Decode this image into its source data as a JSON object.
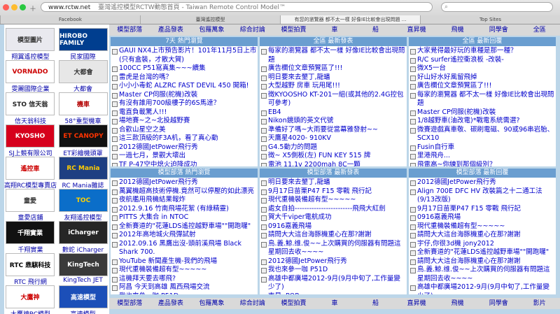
{
  "browser": {
    "url": "www.rctw.net",
    "title": "臺灣遙控模型RCTW動態首頁 - Taiwan Remote Control Model™",
    "tabs": [
      "Facebook",
      "臺灣遙控模型",
      "有您的瀏覽器 都不太一樣 好像IE比較會出現問題 ...",
      "Top Sites"
    ]
  },
  "nav": [
    "模型部落",
    "產品發表",
    "包羅萬象",
    "綜合討論",
    "模型拍賣",
    "車",
    "船",
    "直昇機",
    "飛機",
    "同學會",
    "全區"
  ],
  "nav_bottom": [
    "模型部落",
    "產品發表",
    "包羅萬象",
    "綜合討論",
    "模型拍賣",
    "車",
    "船",
    "直昇機",
    "飛機",
    "同學會",
    "影片"
  ],
  "sidebar": [
    {
      "left": {
        "logo": "模型圖片",
        "caption": "翔翼遙控模型",
        "bg": "#e9e9ef",
        "fg": "#333"
      },
      "right": {
        "logo": "HIROBO FAMILY",
        "caption": "民家國際",
        "bg": "#003e8f",
        "fg": "#ffffff"
      }
    },
    {
      "left": {
        "logo": "VORNADO",
        "caption": "雯麗國際企業",
        "bg": "#ffffff",
        "fg": "#cc0000"
      },
      "right": {
        "logo": "大都會",
        "caption": "大都會",
        "bg": "#e7e7e7",
        "fg": "#333"
      }
    },
    {
      "left": {
        "logo": "STO 信天翁",
        "caption": "信天翁科技",
        "bg": "#ffffff",
        "fg": "#222"
      },
      "right": {
        "logo": "機車",
        "caption": "58°重型機車",
        "bg": "#ffffff",
        "fg": "#b30000"
      }
    },
    {
      "left": {
        "logo": "KYOSHO",
        "caption": "SJ上競有限公司",
        "bg": "#d6001c",
        "fg": "#ffffff"
      },
      "right": {
        "logo": "ET CANOPY",
        "caption": "ET彩繪機頭罩",
        "bg": "#111111",
        "fg": "#ff3300"
      }
    },
    {
      "left": {
        "logo": "遙控車",
        "caption": "高翔RC模型專賣店",
        "bg": "#ffffff",
        "fg": "#cc0000"
      },
      "right": {
        "logo": "RC Mania",
        "caption": "RC Mania雜誌",
        "bg": "#1e3f82",
        "fg": "#ffcc00"
      }
    },
    {
      "left": {
        "logo": "童愛",
        "caption": "童愛店鋪",
        "bg": "#ffffff",
        "fg": "#333"
      },
      "right": {
        "logo": "TOC",
        "caption": "友翔遙控模型",
        "bg": "#0b6ec9",
        "fg": "#ffd000"
      }
    },
    {
      "left": {
        "logo": "千翔實業",
        "caption": "千翔實業",
        "bg": "#111111",
        "fg": "#ffffff"
      },
      "right": {
        "logo": "iCharger",
        "caption": "數蛇 iCharger",
        "bg": "#262626",
        "fg": "#ffffff"
      }
    },
    {
      "left": {
        "logo": "RTC 鼎騏科技",
        "caption": "RTC 飛行網",
        "bg": "#ffffff",
        "fg": "#000"
      },
      "right": {
        "logo": "KingTech",
        "caption": "KingTech JET",
        "bg": "#3a3a3a",
        "fg": "#ffffff"
      }
    },
    {
      "left": {
        "logo": "大鷹神",
        "caption": "大鷹神RC模型",
        "bg": "#ffffff",
        "fg": "#cc0000"
      },
      "right": {
        "logo": "高速模型",
        "caption": "高速模型",
        "bg": "#1c4fb8",
        "fg": "#ffffff"
      }
    }
  ],
  "panels": [
    {
      "header": "7天 熱門瀏覽",
      "items": [
        "GAUI NX4上市預告影片！101年11月5日上市(只有盒裝，才散大賀)",
        "100CC P51寫真集~~~續集",
        "雷虎是台灣的嗎？",
        "小小小毒蛇 ALZRC FAST DEVIL 450 開箱!",
        "Master CP伺服(舵機)改裝",
        "有沒有誰用700級樓子的6S馬達？",
        "電直負載驚人!!!",
        "場地賽~之~北投越野賽",
        "合歡山星空之美",
        "這三款頂級的F3A机，看了真心動",
        "2012德國JetPower飛行秀",
        "一過七月，景觀大壞出",
        "TF P-47空中熄火迫降成功"
      ]
    },
    {
      "header": "全區 最新發表",
      "items": [
        "每家的瀏覽器 都不太一樣 好像IE比較會出現問題",
        "廣告欄位文章預覽區了!!!",
        "明日要來去墾丁,龍蟠",
        "大型越野 房車 玩用尾!!!",
        "徵KYOOSHO KT-201一組(或其他的2.4G控包可參考)",
        "EB4",
        "Nikon鏡頭的英文代號",
        "準備好了嗎~大雨要從當幕雅發射~~",
        "天鷹星4020- 910KV",
        "G4.5動力的問題",
        "徵~ X5側板(左) FUN KEY 515 牌",
        "電池 11.1v 2200mah 8C一顆"
      ]
    },
    {
      "header": "全區 最新回覆",
      "items": [
        "大家覺得最好玩的車種是那一種？",
        "R/C surfer遙控衝浪板 -改裝-",
        "微X5一台",
        "好山好水好風留飛掉",
        "廣告欄位文章預覽區了!!!",
        "每家的瀏覽器 都不太一樣 好像IE比較會出現問題",
        "Master CP伺服(舵機)改裝",
        "1/8越野車(油改電)*戰電系統需選?",
        "微賽遊戲真車敬、碳刷電磁、90或96串岩胎、SCX10",
        "Fusin自行車",
        "里港飛舟...",
        "飛電高~你練到那個級別？"
      ]
    },
    {
      "header": "模型部落 熱門瀏覽",
      "items": [
        "2012德國JetPower飛行秀",
        "萬翼機超高技術停機.竟然可以停壓的如此漂亮",
        "夜航艦用飛機結果報炸",
        "2012.9.16 竹南飛場花絮 (有綠精靈)",
        "PITTS 大集合 in NTOC",
        "全新賽道的\"花蓮LDS遙控越野車場\"\"開跑囉\"",
        "2012年高地城火飛彈試射",
        "2012.09.16 黑鷹出沒-頭前溪飛場 Black Shark 700.",
        "YouTube 新聞產生機-我們的飛場",
        "現代重機裝備超有型~~~~~",
        "這機拜天要去哪飛?",
        "阿昌 今天到高雄 鳳西飛場交流",
        "我也來參一咖 P51D"
      ]
    },
    {
      "header": "模型部落 最新發表",
      "items": [
        "明日要來去墾丁,龍蟠",
        "9月17日苗栗P47 F15 零戰 飛行記",
        "現代重機裝備超有型~~~~~",
        "處女自拍------------------------飛飛大紅劍",
        "賀大千viper電航成功",
        "0916嘉義飛場",
        "請問大大這台海豚機重心在那?謝謝",
        "鳥.義.鯨.维.俊~~上次購買的伺服器有問題這星期回去收~~~~",
        "2012德國JetPower飛行秀",
        "我也來參一咖 P51D",
        "高雄中都廣場2012-9月(9月中旬了,工作量變少了)",
        "南星..POR"
      ]
    },
    {
      "header": "模型部落 最新回覆",
      "items": [
        "2012德國JetPower飛行秀",
        "Align 700E DFC HV 改裝篇之十二通工法 (9/13改版)",
        "9月17日苗栗P47 F15 零戰 飛行記",
        "0916嘉義飛場",
        "現代重機裝備超有型~~~~~",
        "請問大大這台海豚機重心在那?謝謝",
        "宇仔,你很3d機 jony2012",
        "全新賽道的\"花蓮LDS遙控越野車場\"\"開跑囉\"",
        "請問大大這台海豚機重心在那?謝謝",
        "鳥.義.鯨.维.俊~~上次購買的伺服器有問題這星期回去收~~~~",
        "高雄中都廣場2012-9月(9月中旬了,工作量變少了)"
      ]
    }
  ]
}
